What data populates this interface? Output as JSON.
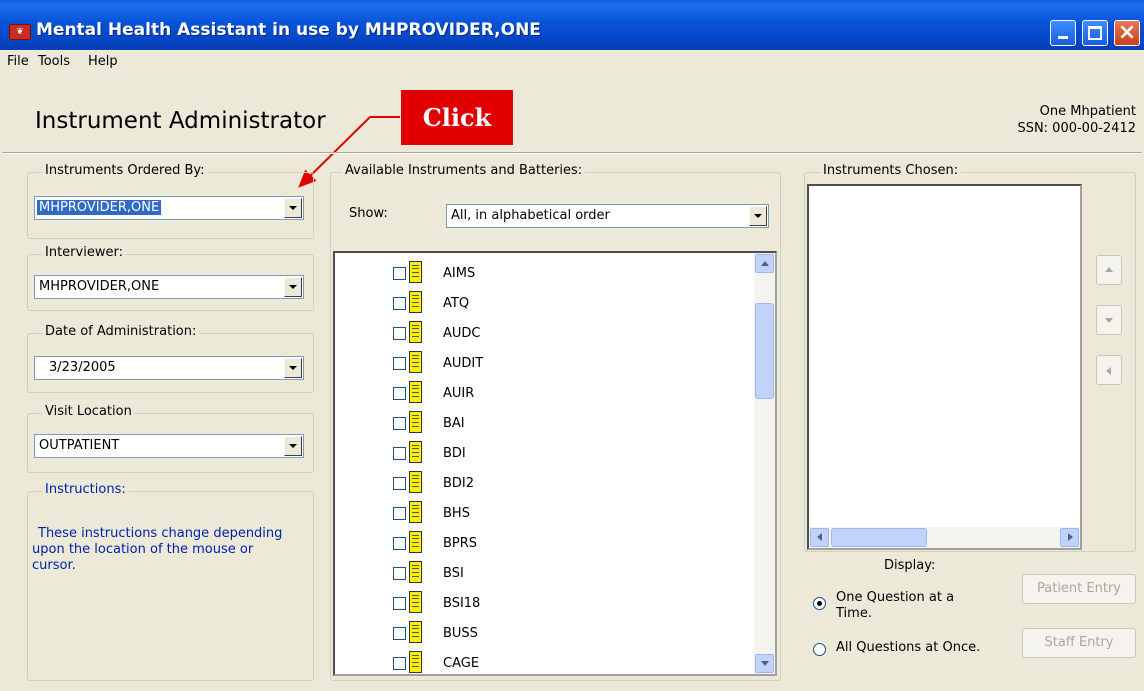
{
  "window": {
    "title": "Mental Health Assistant in use by MHPROVIDER,ONE",
    "app_icon_text": "❦"
  },
  "menu": {
    "items": [
      "File",
      "Tools",
      "Help"
    ]
  },
  "header": {
    "title": "Instrument Administrator",
    "callout": "Click",
    "patient_name": "One Mhpatient",
    "patient_ssn": "SSN: 000-00-2412"
  },
  "left": {
    "ordered_by": {
      "label": "Instruments Ordered By:",
      "value": "MHPROVIDER,ONE"
    },
    "interviewer": {
      "label": "Interviewer:",
      "value": "MHPROVIDER,ONE"
    },
    "date": {
      "label": "Date of Administration:",
      "value": "3/23/2005"
    },
    "location": {
      "label": "Visit Location",
      "value": "OUTPATIENT"
    },
    "instructions": {
      "label": "Instructions:",
      "text": "These instructions change depending upon the location of the mouse or cursor."
    }
  },
  "middle": {
    "group_label": "Available Instruments and Batteries:",
    "show_label": "Show:",
    "show_value": "All, in alphabetical order",
    "instruments": [
      "AIMS",
      "ATQ",
      "AUDC",
      "AUDIT",
      "AUIR",
      "BAI",
      "BDI",
      "BDI2",
      "BHS",
      "BPRS",
      "BSI",
      "BSI18",
      "BUSS",
      "CAGE"
    ]
  },
  "right": {
    "group_label": "Instruments Chosen:",
    "display_label": "Display:",
    "option_one": "One Question at a Time.",
    "option_all": "All Questions at Once.",
    "selected_option": "one",
    "patient_entry": "Patient Entry",
    "staff_entry": "Staff Entry"
  },
  "colors": {
    "callout": "#E10000",
    "instruction_text": "#0022AA",
    "selection": "#316AC5"
  },
  "icons": {
    "instrument": "document-icon",
    "move_up": "arrow-up-icon",
    "move_down": "arrow-down-icon",
    "remove": "arrow-left-icon"
  }
}
